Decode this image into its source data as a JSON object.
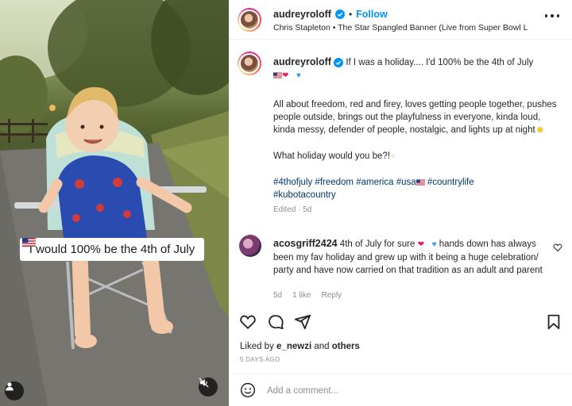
{
  "photo": {
    "sticker_text": "I would 100% be the 4th of July",
    "user_icon": "user-icon",
    "mute_icon": "mute-icon"
  },
  "header": {
    "username": "audreyroloff",
    "follow_label": "Follow",
    "song": "Chris Stapleton • The Star Spangled Banner (Live from Super Bowl L",
    "more_icon": "more-options-icon"
  },
  "caption": {
    "username": "audreyroloff",
    "line1": "If I was a holiday.... I'd 100% be the 4th of July",
    "paragraph": "All about freedom, red and firey, loves getting people together, pushes people outside, brings out the playfulness in everyone, kinda loud, kinda messy, defender of people, nostalgic, and lights up at night",
    "question": "What holiday would you be?!",
    "hashtags": "#4thofjuly #freedom #america #usa",
    "hashtags2": " #countrylife",
    "hashtags3": "#kubotacountry",
    "edited": "Edited · 5d"
  },
  "comment": {
    "username": "acosgriff2424",
    "text_part1": " 4th of July for sure ",
    "text_part2": " hands down has always been my fav holiday and grew up with it being a huge celebration/ party and have now carried on that tradition as an adult and parent",
    "age": "5d",
    "likes": "1 like",
    "reply": "Reply"
  },
  "footer": {
    "liked_prefix": "Liked by ",
    "liked_user": "e_newzi",
    "liked_and": " and ",
    "liked_others": "others",
    "date": "5 DAYS AGO",
    "add_comment_placeholder": "Add a comment..."
  },
  "colors": {
    "link_blue": "#0095f6",
    "hashtag": "#00376b",
    "muted": "#8e8e8e"
  }
}
